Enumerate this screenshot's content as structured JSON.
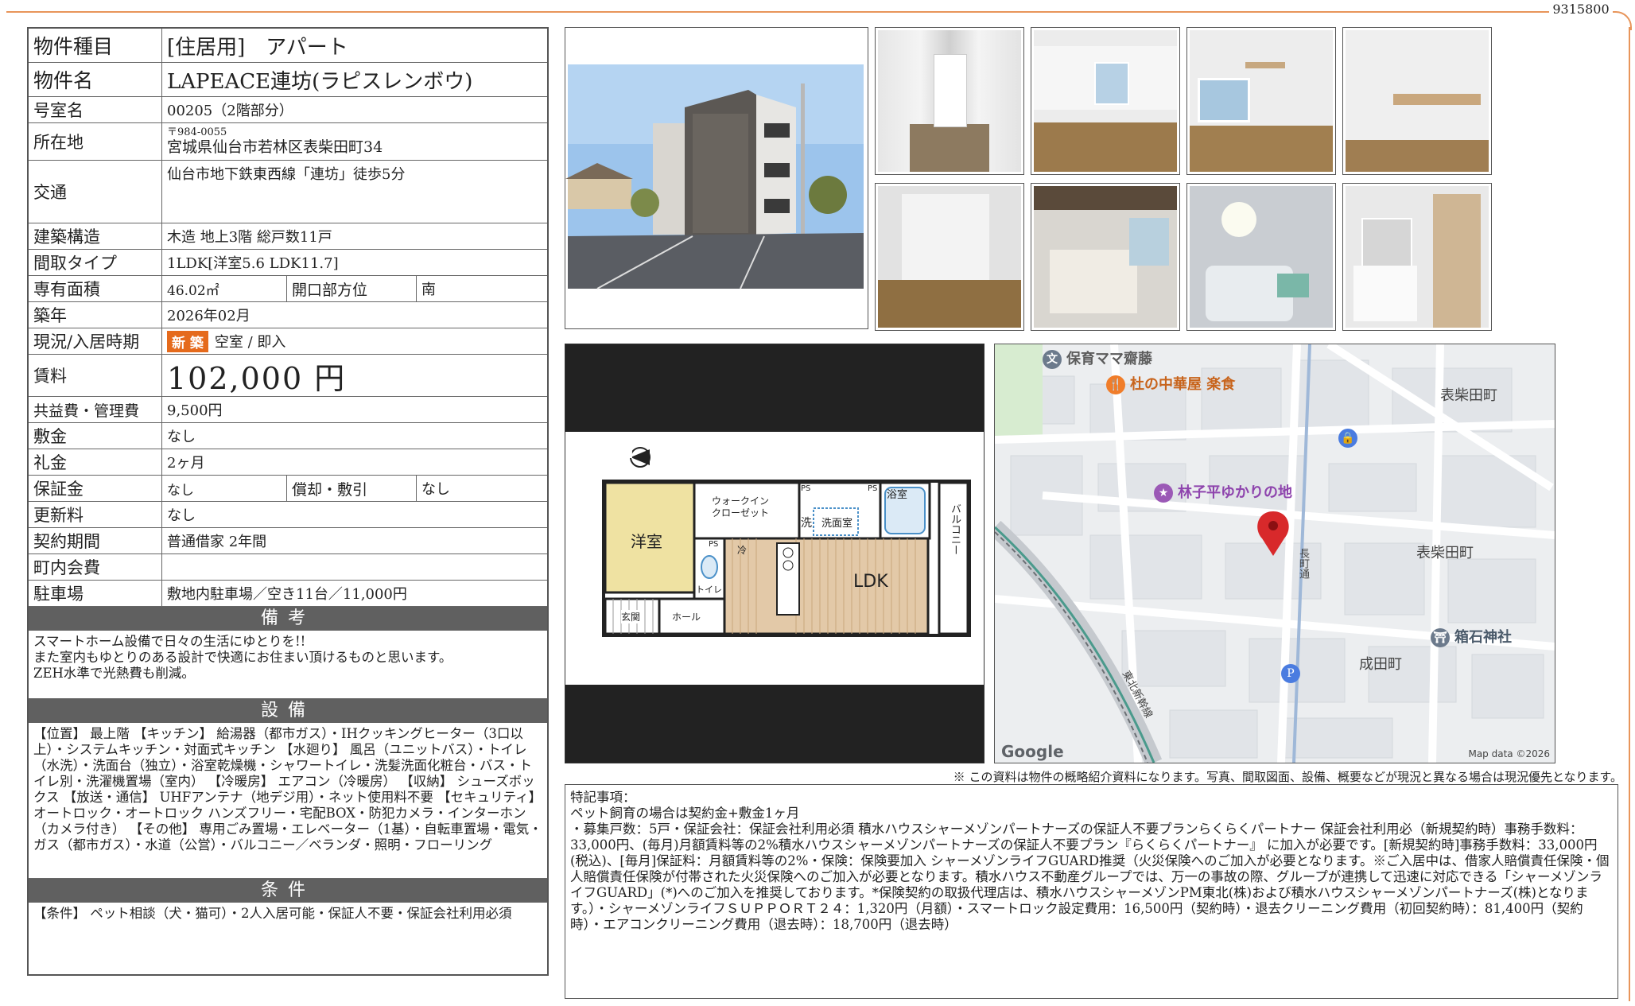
{
  "doc_number": "9315800",
  "table": {
    "type_label": "物件種目",
    "type_value": "[住居用]　アパート",
    "name_label": "物件名",
    "name_value": "LAPEACE連坊(ラピスレンボウ)",
    "room_label": "号室名",
    "room_value": "00205（2階部分）",
    "address_label": "所在地",
    "postal": "〒984-0055",
    "address_value": "宮城県仙台市若林区表柴田町34",
    "transit_label": "交通",
    "transit_value": "仙台市地下鉄東西線「連坊」徒歩5分",
    "structure_label": "建築構造",
    "structure_value": "木造 地上3階 総戸数11戸",
    "layout_label": "間取タイプ",
    "layout_value": "1LDK[洋室5.6 LDK11.7]",
    "area_label": "専有面積",
    "area_value": "46.02㎡",
    "direction_label": "開口部方位",
    "direction_value": "南",
    "built_label": "築年",
    "built_value": "2026年02月",
    "status_label": "現況/入居時期",
    "status_badge": "新 築",
    "status_value": "空室 / 即入",
    "rent_label": "賃料",
    "rent_value": "102,000 円",
    "fee_label": "共益費・管理費",
    "fee_value": "9,500円",
    "deposit_label": "敷金",
    "deposit_value": "なし",
    "key_label": "礼金",
    "key_value": "2ヶ月",
    "guarantee_label": "保証金",
    "guarantee_value": "なし",
    "amort_label": "償却・敷引",
    "amort_value": "なし",
    "renewal_label": "更新料",
    "renewal_value": "なし",
    "contract_label": "契約期間",
    "contract_value": "普通借家 2年間",
    "assoc_label": "町内会費",
    "assoc_value": "",
    "parking_label": "駐車場",
    "parking_value": "敷地内駐車場／空き11台／11,000円"
  },
  "remarks": {
    "head": "備考",
    "line1": "スマートホーム設備で日々の生活にゆとりを!!",
    "line2": "また室内もゆとりのある設計で快適にお住まい頂けるものと思います。",
    "line3": "ZEH水準で光熱費も削減。"
  },
  "equipment": {
    "head": "設備",
    "text": "【位置】 最上階 【キッチン】 給湯器（都市ガス）・IHクッキングヒーター（3口以上）・システムキッチン・対面式キッチン 【水廻り】 風呂（ユニットバス）・トイレ（水洗）・洗面台（独立）・浴室乾燥機・シャワートイレ・洗髪洗面化粧台・バス・トイレ別・洗濯機置場（室内） 【冷暖房】 エアコン（冷暖房） 【収納】 シューズボックス 【放送・通信】 UHFアンテナ（地デジ用）・ネット使用料不要 【セキュリティ】 オートロック・オートロック ハンズフリー・宅配BOX・防犯カメラ・インターホン（カメラ付き） 【その他】 専用ごみ置場・エレベーター（1基）・自転車置場・電気・ガス（都市ガス）・水道（公営）・バルコニー／ベランダ・照明・フローリング"
  },
  "conditions": {
    "head": "条件",
    "text": "【条件】 ペット相談（犬・猫可）・2人入居可能・保証人不要・保証会社利用必須"
  },
  "floorplan": {
    "north": "N",
    "room_western": "洋室",
    "walkin": "ウォークイン\nクローゼット",
    "ps1": "PS",
    "ps2": "PS",
    "ps3": "PS",
    "wash_mark": "洗",
    "washroom": "洗面室",
    "bath": "浴室",
    "balcony": "バルコニー",
    "fridge": "冷",
    "toilet": "トイレ",
    "ldk": "LDK",
    "entrance": "玄関",
    "hall": "ホール"
  },
  "map": {
    "poi_school": "保育ママ齋藤",
    "poi_food": "杜の中華屋 楽食",
    "poi_park": "林子平ゆかりの地",
    "poi_shrine": "箱石神社",
    "area1": "表柴田町",
    "area2": "表柴田町",
    "area3": "成田町",
    "street": "長町通",
    "railway": "東北新幹線",
    "google": "Google",
    "mapdata": "Map data ©2026"
  },
  "disclaimer": "※ この資料は物件の概略紹介資料になります。写真、間取図面、設備、概要などが現況と異なる場合は現況優先となります。",
  "special": {
    "title": "特記事項：",
    "text": "ペット飼育の場合は契約金+敷金1ヶ月\n・募集戸数：5戸・保証会社：保証会社利用必須 積水ハウスシャーメゾンパートナーズの保証人不要プランらくらくパートナー 保証会社利用必（新規契約時）事務手数料：33,000円、(毎月)月額賃料等の2%積水ハウスシャーメゾンパートナーズの保証人不要プラン『らくらくパートナー』 に加入が必要です。[新規契約時]事務手数料：33,000円(税込)、[毎月]保証料：月額賃料等の2%・保険：保険要加入 シャーメゾンライフGUARD推奨（火災保険へのご加入が必要となります。※ご入居中は、借家人賠償責任保険・個人賠償責任保険が付帯された火災保険へのご加入が必要となります。積水ハウス不動産グループでは、万一の事故の際、グループが連携して迅速に対応できる「シャーメゾンライフGUARD」(*)へのご加入を推奨しております。*保険契約の取扱代理店は、積水ハウスシャーメゾンPM東北(株)および積水ハウスシャーメゾンパートナーズ(株)となります。）・シャーメゾンライフＳＵＰＰＯＲＴ２４：1,320円（月額）・スマートロック設定費用：16,500円（契約時）・退去クリーニング費用（初回契約時）：81,400円（契約時）・エアコンクリーニング費用（退去時）：18,700円（退去時）"
  }
}
